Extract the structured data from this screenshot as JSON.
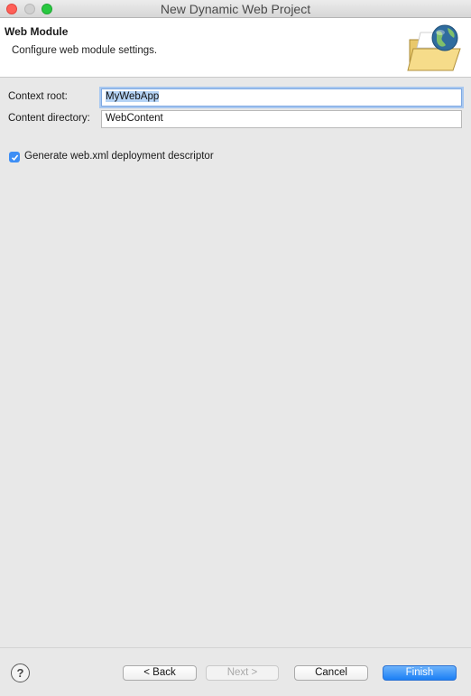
{
  "window": {
    "title": "New Dynamic Web Project"
  },
  "header": {
    "title": "Web Module",
    "description": "Configure web module settings."
  },
  "form": {
    "context_root_label": "Context root:",
    "context_root_value": "MyWebApp",
    "content_dir_label": "Content directory:",
    "content_dir_value": "WebContent",
    "generate_label": "Generate web.xml deployment descriptor",
    "generate_checked": true
  },
  "buttons": {
    "help": "?",
    "back": "< Back",
    "next": "Next >",
    "cancel": "Cancel",
    "finish": "Finish"
  },
  "colors": {
    "accent": "#1b7ff5",
    "checkbox": "#3d8ef5",
    "selection": "#b5d3f5"
  },
  "icons": {
    "header_icon": "folder-globe-icon",
    "window_controls": [
      "close-icon",
      "minimize-icon",
      "maximize-icon"
    ]
  }
}
